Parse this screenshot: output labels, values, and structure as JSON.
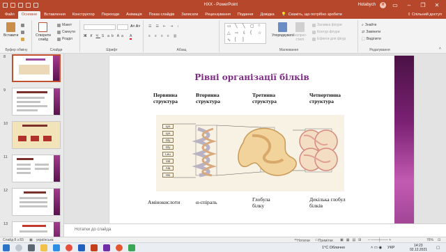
{
  "window": {
    "doc_name": "НХХ  -  PowerPoint",
    "user_name": "Hotabych",
    "user_initials": "H"
  },
  "tabs": [
    {
      "label": "Файл"
    },
    {
      "label": "Основне"
    },
    {
      "label": "Вставлення"
    },
    {
      "label": "Конструктор"
    },
    {
      "label": "Переходи"
    },
    {
      "label": "Анімація"
    },
    {
      "label": "Показ слайдів"
    },
    {
      "label": "Записати"
    },
    {
      "label": "Рецензування"
    },
    {
      "label": "Подання"
    },
    {
      "label": "Довідка"
    }
  ],
  "search_tab": "Скажіть, що потрібно зробити",
  "share_label": "Спільний доступ",
  "ribbon": {
    "clipboard": {
      "paste": "Вставити",
      "group": "Буфер обміну"
    },
    "slides": {
      "new_slide_line1": "Створити",
      "new_slide_line2": "слайд",
      "layout": "Макет",
      "reset": "Скинути",
      "section": "Розділ",
      "group": "Слайди"
    },
    "font": {
      "group": "Шрифт"
    },
    "paragraph": {
      "group": "Абзац"
    },
    "drawing": {
      "arrange": "Упорядкувати",
      "quick_styles_line1": "Експрес-",
      "quick_styles_line2": "стилі",
      "fill": "Заливка фігури",
      "outline": "Контур фігури",
      "effects": "Ефекти для фігур",
      "group": "Малювання"
    },
    "editing": {
      "find": "Знайти",
      "replace": "Замінити",
      "select": "Виділити",
      "group": "Редагування"
    }
  },
  "thumbnails": [
    {
      "num": "8",
      "selected": true
    },
    {
      "num": "9",
      "selected": false
    },
    {
      "num": "10",
      "selected": false
    },
    {
      "num": "11",
      "selected": false
    },
    {
      "num": "12",
      "selected": false
    },
    {
      "num": "13",
      "selected": false
    }
  ],
  "slide": {
    "title": "Рівні організації білків",
    "headers": [
      {
        "line1": "Первинна",
        "line2": "структура"
      },
      {
        "line1": "Вторинна",
        "line2": "структура"
      },
      {
        "line1": "Третинна",
        "line2": "структура"
      },
      {
        "line1": "Четвертинна",
        "line2": "структура"
      }
    ],
    "amino_acids": [
      "Lys",
      "Lys",
      "Gly",
      "Gly",
      "Leu",
      "Val",
      "Ala",
      "His"
    ],
    "captions": [
      {
        "line1": "Амінокислоти",
        "line2": ""
      },
      {
        "line1": "α-спіраль",
        "line2": ""
      },
      {
        "line1": "Глобула",
        "line2": "білку"
      },
      {
        "line1": "Декілька глобул",
        "line2": "білків"
      }
    ]
  },
  "notes_placeholder": "Нотатки до слайда",
  "status": {
    "slide_counter": "Слайд 8 з 83",
    "language": "українська",
    "notes": "Нотатки",
    "comments": "Примітки",
    "zoom": "76%"
  },
  "taskbar": {
    "weather": "1°C  Облачно",
    "lang": "УКР",
    "time": "14:23",
    "date": "02.12.2021"
  },
  "colors": {
    "accent": "#b7472a",
    "title": "#7f2b86",
    "deco": "#7b2173"
  }
}
